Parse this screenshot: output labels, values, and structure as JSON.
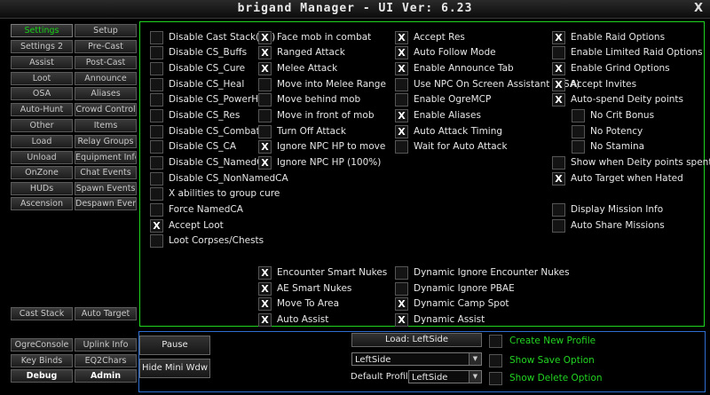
{
  "window": {
    "title": "brigand Manager  - UI Ver: 6.23",
    "close_label": "X"
  },
  "nav": {
    "settings": "Settings",
    "setup": "Setup",
    "settings2": "Settings 2",
    "precast": "Pre-Cast",
    "assist": "Assist",
    "postcast": "Post-Cast",
    "loot": "Loot",
    "announce": "Announce",
    "osa": "OSA",
    "aliases": "Aliases",
    "autohunt": "Auto-Hunt",
    "crowdcontrol": "Crowd Control",
    "other": "Other",
    "items": "Items",
    "load": "Load",
    "relaygroups": "Relay Groups",
    "unload": "Unload",
    "equipmentinfo": "Equipment Info",
    "onzone": "OnZone",
    "chatevents": "Chat Events",
    "huds": "HUDs",
    "spawnevents": "Spawn Events",
    "ascension": "Ascension",
    "despawnevent": "Despawn Event",
    "caststack": "Cast Stack",
    "autotarget": "Auto Target",
    "ogreconsole": "OgreConsole",
    "uplinkinfo": "Uplink Info",
    "keybinds": "Key Binds",
    "eq2chars": "EQ2Chars",
    "debug": "Debug",
    "admin": "Admin"
  },
  "options": {
    "col1": [
      {
        "label": "Disable Cast Stack(CS)",
        "checked": false
      },
      {
        "label": "Disable CS_Buffs",
        "checked": false
      },
      {
        "label": "Disable CS_Cure",
        "checked": false
      },
      {
        "label": "Disable CS_Heal",
        "checked": false
      },
      {
        "label": "Disable CS_PowerHeal",
        "checked": false
      },
      {
        "label": "Disable CS_Res",
        "checked": false
      },
      {
        "label": "Disable CS_Combat",
        "checked": false
      },
      {
        "label": "Disable CS_CA",
        "checked": false
      },
      {
        "label": "Disable CS_NamedCA",
        "checked": false
      },
      {
        "label": "Disable CS_NonNamedCA",
        "checked": false
      },
      {
        "label": "X abilities to group cure",
        "checked": false
      },
      {
        "label": "Force NamedCA",
        "checked": false
      },
      {
        "label": "Accept Loot",
        "checked": true
      },
      {
        "label": "Loot Corpses/Chests",
        "checked": false
      }
    ],
    "col2": [
      {
        "label": "Face mob in combat",
        "checked": true
      },
      {
        "label": "Ranged Attack",
        "checked": true
      },
      {
        "label": "Melee Attack",
        "checked": true
      },
      {
        "label": "Move into Melee Range",
        "checked": false
      },
      {
        "label": "Move behind mob",
        "checked": false
      },
      {
        "label": "Move in front of mob",
        "checked": false
      },
      {
        "label": "Turn Off Attack",
        "checked": false
      },
      {
        "label": "Ignore NPC HP to move",
        "checked": true
      },
      {
        "label": "Ignore NPC HP (100%)",
        "checked": true
      }
    ],
    "col3": [
      {
        "label": "Accept Res",
        "checked": true
      },
      {
        "label": "Auto Follow Mode",
        "checked": true
      },
      {
        "label": "Enable Announce Tab",
        "checked": true
      },
      {
        "label": "Use NPC On Screen Assistant (OSA)",
        "checked": false
      },
      {
        "label": "Enable OgreMCP",
        "checked": false
      },
      {
        "label": "Enable Aliases",
        "checked": true
      },
      {
        "label": "Auto Attack Timing",
        "checked": true
      },
      {
        "label": "Wait for Auto Attack",
        "checked": false
      }
    ],
    "col4a": [
      {
        "label": "Enable Raid Options",
        "checked": true
      },
      {
        "label": "Enable Limited Raid Options",
        "checked": false
      },
      {
        "label": "Enable Grind Options",
        "checked": true
      },
      {
        "label": "Accept Invites",
        "checked": true
      },
      {
        "label": "Auto-spend Deity points",
        "checked": true
      }
    ],
    "col4sub": [
      {
        "label": "No Crit Bonus",
        "checked": false
      },
      {
        "label": "No Potency",
        "checked": false
      },
      {
        "label": "No Stamina",
        "checked": false
      }
    ],
    "col4b": [
      {
        "label": "Show when Deity points spent",
        "checked": false
      },
      {
        "label": "Auto Target when Hated",
        "checked": true
      }
    ],
    "col4c": [
      {
        "label": "Display Mission Info",
        "checked": false
      },
      {
        "label": "Auto Share Missions",
        "checked": false
      }
    ],
    "lower_left": [
      {
        "label": "Encounter Smart Nukes",
        "checked": true
      },
      {
        "label": "AE Smart Nukes",
        "checked": true
      },
      {
        "label": "Move To Area",
        "checked": true
      },
      {
        "label": "Auto Assist",
        "checked": true
      }
    ],
    "lower_right": [
      {
        "label": "Dynamic Ignore Encounter Nukes",
        "checked": false
      },
      {
        "label": "Dynamic Ignore PBAE",
        "checked": false
      },
      {
        "label": "Dynamic Camp Spot",
        "checked": true
      },
      {
        "label": "Dynamic Assist",
        "checked": true
      }
    ]
  },
  "bottom": {
    "pause_label": "Pause",
    "hide_mini_label": "Hide Mini Wdw",
    "load_label": "Load: LeftSide",
    "profile_select": "LeftSide",
    "default_profile_label": "Default Profile:",
    "default_profile_select": "LeftSide",
    "create_profile": "Create New Profile",
    "show_save": "Show Save Option",
    "show_delete": "Show Delete Option"
  },
  "colors": {
    "accent_green": "#1fd41f",
    "accent_blue": "#2c6fd0",
    "background": "#000000"
  }
}
